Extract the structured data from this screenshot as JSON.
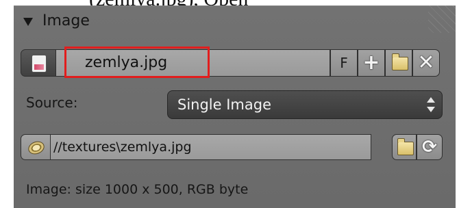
{
  "caption": {
    "text": "(zemlya.jpg), Open"
  },
  "panel": {
    "title": "Image",
    "image_name": "zemlya.jpg",
    "fake_user_label": "F",
    "new_icon": "plus-icon",
    "open_icon": "folder-icon",
    "unlink_icon": "x-icon",
    "highlight_color": "#e21d1d",
    "source": {
      "label": "Source:",
      "value": "Single Image"
    },
    "filepath": {
      "value": "//textures\\zemlya.jpg",
      "pack_icon": "package-icon",
      "open_icon": "folder-icon",
      "reload_icon": "reload-icon"
    },
    "info": "Image: size 1000 x 500, RGB byte"
  }
}
